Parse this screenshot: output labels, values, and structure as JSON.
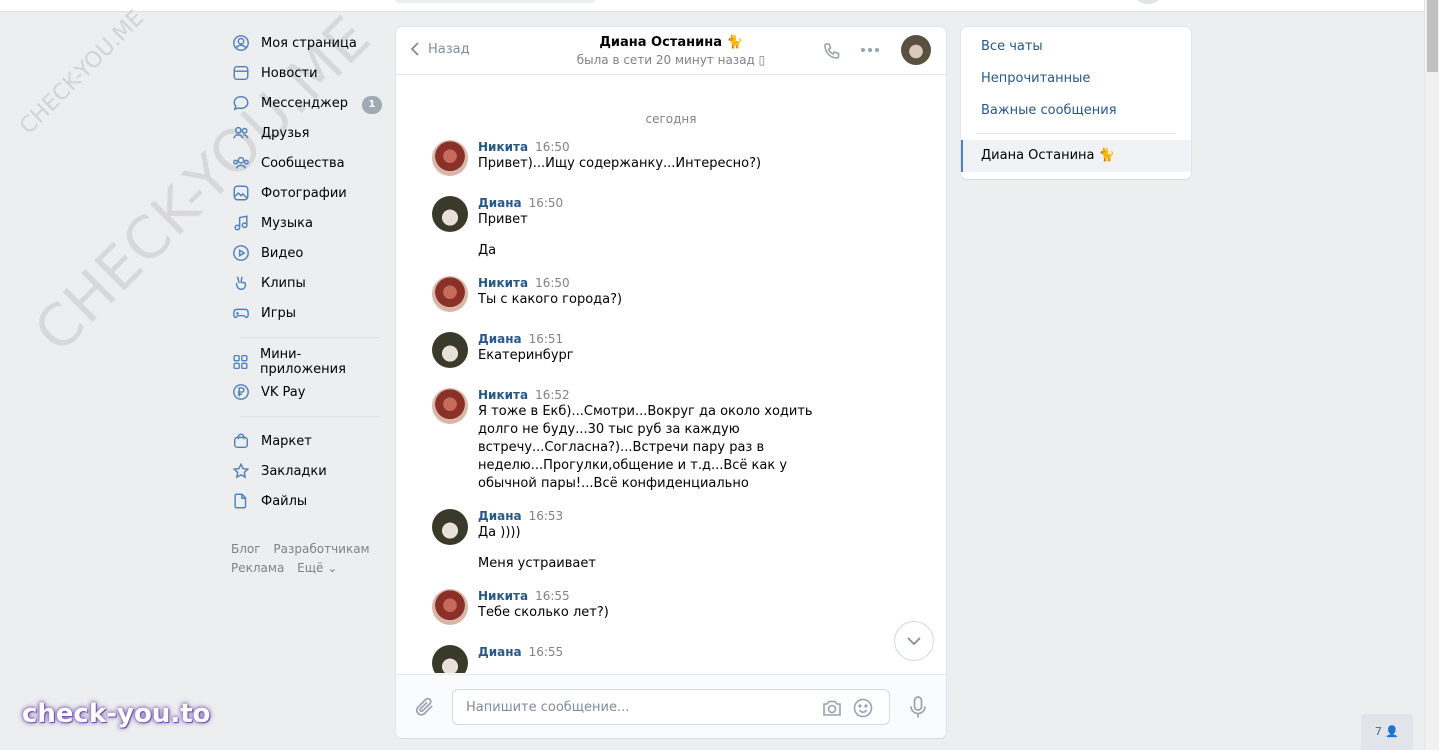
{
  "nav": {
    "items": [
      {
        "label": "Моя страница",
        "icon": "user-circle-icon"
      },
      {
        "label": "Новости",
        "icon": "newspaper-icon"
      },
      {
        "label": "Мессенджер",
        "icon": "message-bubble-icon",
        "badge": "1"
      },
      {
        "label": "Друзья",
        "icon": "friends-icon"
      },
      {
        "label": "Сообщества",
        "icon": "communities-icon"
      },
      {
        "label": "Фотографии",
        "icon": "photo-icon"
      },
      {
        "label": "Музыка",
        "icon": "music-note-icon"
      },
      {
        "label": "Видео",
        "icon": "play-circle-icon"
      },
      {
        "label": "Клипы",
        "icon": "clips-icon"
      },
      {
        "label": "Игры",
        "icon": "gamepad-icon"
      }
    ],
    "items2": [
      {
        "label": "Мини-приложения",
        "icon": "apps-grid-icon"
      },
      {
        "label": "VK Pay",
        "icon": "ruble-circle-icon"
      }
    ],
    "items3": [
      {
        "label": "Маркет",
        "icon": "shopping-bag-icon"
      },
      {
        "label": "Закладки",
        "icon": "star-icon"
      },
      {
        "label": "Файлы",
        "icon": "file-icon"
      }
    ],
    "footer": {
      "blog": "Блог",
      "dev": "Разработчикам",
      "ads": "Реклама",
      "more": "Ещё ⌄"
    }
  },
  "chat": {
    "back_label": "Назад",
    "peer_name": "Диана Останина 🐈",
    "peer_status": "была в сети 20 минут назад ▯",
    "day_label": "сегодня",
    "messages": [
      {
        "author": "Никита",
        "time": "16:50",
        "lines": [
          "Привет)...Ищу содержанку...Интересно?)"
        ]
      },
      {
        "author": "Диана",
        "time": "16:50",
        "lines": [
          "Привет",
          "Да"
        ]
      },
      {
        "author": "Никита",
        "time": "16:50",
        "lines": [
          "Ты с какого города?)"
        ]
      },
      {
        "author": "Диана",
        "time": "16:51",
        "lines": [
          "Екатеринбург"
        ]
      },
      {
        "author": "Никита",
        "time": "16:52",
        "lines": [
          "Я тоже в Екб)...Смотри...Вокруг да около ходить долго не буду...30 тыс руб за каждую встречу...Согласна?)...Встречи пару раз в неделю...Прогулки,общение и т.д...Всё как у обычной пары!...Всё конфиденциально"
        ]
      },
      {
        "author": "Диана",
        "time": "16:53",
        "lines": [
          "Да ))))",
          "Меня устраивает"
        ]
      },
      {
        "author": "Никита",
        "time": "16:55",
        "lines": [
          "Тебе сколько лет?)"
        ]
      },
      {
        "author": "Диана",
        "time": "16:55",
        "lines": [
          ""
        ]
      }
    ],
    "composer_placeholder": "Напишите сообщение..."
  },
  "filters": {
    "all": "Все чаты",
    "unread": "Непрочитанные",
    "important": "Важные сообщения",
    "active_chat": "Диана Останина 🐈"
  },
  "online_counter": "7 👤",
  "watermarks": {
    "big": "CHECK-YOU.ME",
    "small": "CHECK-YOU.ME",
    "brand": "check-you.to"
  },
  "colors": {
    "link": "#2a5885",
    "accent": "#5181b8",
    "bg": "#edeef0"
  }
}
